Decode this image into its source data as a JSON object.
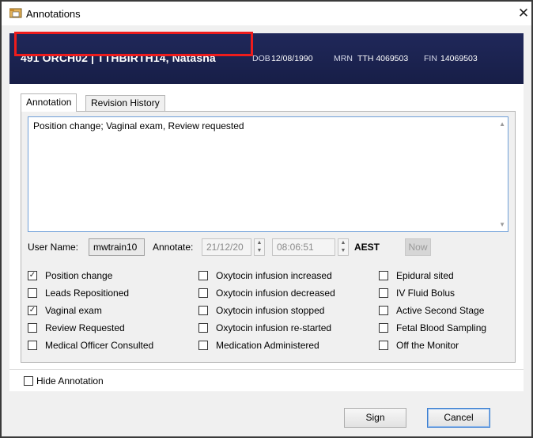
{
  "window": {
    "title": "Annotations",
    "close_glyph": "✕"
  },
  "banner": {
    "patient_line": "491 ORCH02 | TTHBIRTH14, Natasha",
    "dob_label": "DOB",
    "dob_value": "12/08/1990",
    "mrn_label": "MRN",
    "mrn_value": "TTH 4069503",
    "fin_label": "FIN",
    "fin_value": "14069503"
  },
  "tabs": [
    {
      "label": "Annotation",
      "active": true
    },
    {
      "label": "Revision History",
      "active": false
    }
  ],
  "annotation_text": "Position change; Vaginal exam, Review requested",
  "user": {
    "user_name_label": "User Name:",
    "user_name": "mwtrain10",
    "annotate_label": "Annotate:",
    "date": "21/12/20",
    "time": "08:06:51",
    "tz": "AEST",
    "now_label": "Now"
  },
  "checkboxes": {
    "col1": [
      {
        "label": "Position change",
        "checked": "✓"
      },
      {
        "label": "Leads Repositioned",
        "checked": ""
      },
      {
        "label": "Vaginal exam",
        "checked": "✓"
      },
      {
        "label": "Review Requested",
        "checked": ""
      },
      {
        "label": "Medical Officer Consulted",
        "checked": ""
      }
    ],
    "col2": [
      {
        "label": "Oxytocin infusion increased",
        "checked": ""
      },
      {
        "label": "Oxytocin infusion decreased",
        "checked": ""
      },
      {
        "label": "Oxytocin infusion stopped",
        "checked": ""
      },
      {
        "label": "Oxytocin infusion re-started",
        "checked": ""
      },
      {
        "label": "Medication Administered",
        "checked": ""
      }
    ],
    "col3": [
      {
        "label": "Epidural sited",
        "checked": ""
      },
      {
        "label": "IV Fluid Bolus",
        "checked": ""
      },
      {
        "label": "Active Second Stage",
        "checked": ""
      },
      {
        "label": "Fetal Blood Sampling",
        "checked": ""
      },
      {
        "label": "Off the Monitor",
        "checked": ""
      }
    ]
  },
  "hide_annotation": {
    "label": "Hide Annotation",
    "checked": ""
  },
  "buttons": {
    "sign": "Sign",
    "cancel": "Cancel"
  },
  "colors": {
    "banner": "#1c2450",
    "highlight": "#ee1c1c",
    "focus": "#3c7fd1"
  },
  "icons": {
    "app": "folder-icon",
    "close": "close-icon",
    "spin": "spinner-icon",
    "check": "checkmark-icon"
  }
}
